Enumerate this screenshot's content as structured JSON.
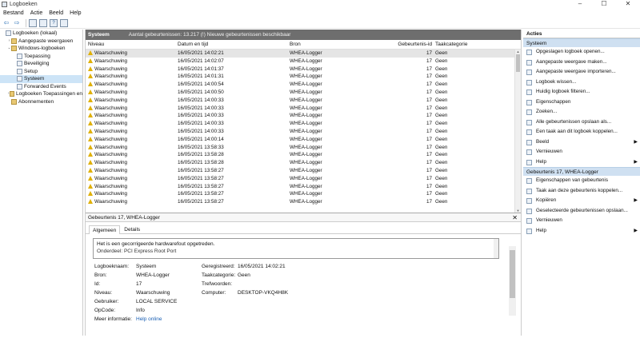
{
  "window": {
    "title": "Logboeken",
    "controls": [
      "–",
      "☐",
      "✕"
    ]
  },
  "menu": [
    "Bestand",
    "Actie",
    "Beeld",
    "Help"
  ],
  "tree": [
    {
      "label": "Logboeken (lokaal)",
      "depth": 0,
      "expand": "",
      "selected": false
    },
    {
      "label": "Aangepaste weergaven",
      "depth": 1,
      "expand": "›",
      "selected": false
    },
    {
      "label": "Windows-logboeken",
      "depth": 1,
      "expand": "⌄",
      "selected": false
    },
    {
      "label": "Toepassing",
      "depth": 2,
      "expand": "",
      "selected": false
    },
    {
      "label": "Beveiliging",
      "depth": 2,
      "expand": "",
      "selected": false
    },
    {
      "label": "Setup",
      "depth": 2,
      "expand": "",
      "selected": false
    },
    {
      "label": "Systeem",
      "depth": 2,
      "expand": "",
      "selected": true
    },
    {
      "label": "Forwarded Events",
      "depth": 2,
      "expand": "",
      "selected": false
    },
    {
      "label": "Logboeken Toepassingen en",
      "depth": 1,
      "expand": "›",
      "selected": false
    },
    {
      "label": "Abonnementen",
      "depth": 1,
      "expand": "",
      "selected": false
    }
  ],
  "log_header": {
    "name": "Systeem",
    "info": "Aantal gebeurtenissen: 13.217 (!) Nieuwe gebeurtenissen beschikbaar"
  },
  "columns": [
    "Niveau",
    "Datum en tijd",
    "Bron",
    "Gebeurtenis-id",
    "Taakcategorie"
  ],
  "events": [
    {
      "level": "Waarschuwing",
      "datetime": "16/05/2021 14:02:21",
      "source": "WHEA-Logger",
      "id": "17",
      "category": "Geen"
    },
    {
      "level": "Waarschuwing",
      "datetime": "16/05/2021 14:02:07",
      "source": "WHEA-Logger",
      "id": "17",
      "category": "Geen"
    },
    {
      "level": "Waarschuwing",
      "datetime": "16/05/2021 14:01:37",
      "source": "WHEA-Logger",
      "id": "17",
      "category": "Geen"
    },
    {
      "level": "Waarschuwing",
      "datetime": "16/05/2021 14:01:31",
      "source": "WHEA-Logger",
      "id": "17",
      "category": "Geen"
    },
    {
      "level": "Waarschuwing",
      "datetime": "16/05/2021 14:00:54",
      "source": "WHEA-Logger",
      "id": "17",
      "category": "Geen"
    },
    {
      "level": "Waarschuwing",
      "datetime": "16/05/2021 14:00:50",
      "source": "WHEA-Logger",
      "id": "17",
      "category": "Geen"
    },
    {
      "level": "Waarschuwing",
      "datetime": "16/05/2021 14:00:33",
      "source": "WHEA-Logger",
      "id": "17",
      "category": "Geen"
    },
    {
      "level": "Waarschuwing",
      "datetime": "16/05/2021 14:00:33",
      "source": "WHEA-Logger",
      "id": "17",
      "category": "Geen"
    },
    {
      "level": "Waarschuwing",
      "datetime": "16/05/2021 14:00:33",
      "source": "WHEA-Logger",
      "id": "17",
      "category": "Geen"
    },
    {
      "level": "Waarschuwing",
      "datetime": "16/05/2021 14:00:33",
      "source": "WHEA-Logger",
      "id": "17",
      "category": "Geen"
    },
    {
      "level": "Waarschuwing",
      "datetime": "16/05/2021 14:00:33",
      "source": "WHEA-Logger",
      "id": "17",
      "category": "Geen"
    },
    {
      "level": "Waarschuwing",
      "datetime": "16/05/2021 14:00:14",
      "source": "WHEA-Logger",
      "id": "17",
      "category": "Geen"
    },
    {
      "level": "Waarschuwing",
      "datetime": "16/05/2021 13:58:33",
      "source": "WHEA-Logger",
      "id": "17",
      "category": "Geen"
    },
    {
      "level": "Waarschuwing",
      "datetime": "16/05/2021 13:58:28",
      "source": "WHEA-Logger",
      "id": "17",
      "category": "Geen"
    },
    {
      "level": "Waarschuwing",
      "datetime": "16/05/2021 13:58:28",
      "source": "WHEA-Logger",
      "id": "17",
      "category": "Geen"
    },
    {
      "level": "Waarschuwing",
      "datetime": "16/05/2021 13:58:27",
      "source": "WHEA-Logger",
      "id": "17",
      "category": "Geen"
    },
    {
      "level": "Waarschuwing",
      "datetime": "16/05/2021 13:58:27",
      "source": "WHEA-Logger",
      "id": "17",
      "category": "Geen"
    },
    {
      "level": "Waarschuwing",
      "datetime": "16/05/2021 13:58:27",
      "source": "WHEA-Logger",
      "id": "17",
      "category": "Geen"
    },
    {
      "level": "Waarschuwing",
      "datetime": "16/05/2021 13:58:27",
      "source": "WHEA-Logger",
      "id": "17",
      "category": "Geen"
    },
    {
      "level": "Waarschuwing",
      "datetime": "16/05/2021 13:58:27",
      "source": "WHEA-Logger",
      "id": "17",
      "category": "Geen"
    }
  ],
  "detail": {
    "title": "Gebeurtenis 17, WHEA-Logger",
    "close": "✕",
    "tabs": [
      "Algemeen",
      "Details"
    ],
    "message_line1": "Het is een gecorrigeerde hardwarefout opgetreden.",
    "message_line2": "Onderdeel: PCI Express Root Port",
    "props_left": [
      {
        "label": "Logboeknaam:",
        "value": "Systeem"
      },
      {
        "label": "Bron:",
        "value": "WHEA-Logger"
      },
      {
        "label": "Id:",
        "value": "17"
      },
      {
        "label": "Niveau:",
        "value": "Waarschuwing"
      },
      {
        "label": "Gebruiker:",
        "value": "LOCAL SERVICE"
      },
      {
        "label": "OpCode:",
        "value": "Info"
      },
      {
        "label": "Meer informatie:",
        "value": "Help online"
      }
    ],
    "props_right": [
      {
        "label": "Geregistreerd:",
        "value": "16/05/2021 14:02:21"
      },
      {
        "label": "Taakcategorie:",
        "value": "Geen"
      },
      {
        "label": "Trefwoorden:",
        "value": ""
      },
      {
        "label": "Computer:",
        "value": "DESKTOP-VKQ4H8K"
      }
    ]
  },
  "actions": {
    "header": "Acties",
    "section1": "Systeem",
    "items1": [
      {
        "label": "Opgeslagen logboek openen...",
        "submenu": false
      },
      {
        "label": "Aangepaste weergave maken...",
        "submenu": false
      },
      {
        "label": "Aangepaste weergave importeren...",
        "submenu": false
      },
      {
        "label": "Logboek wissen...",
        "submenu": false
      },
      {
        "label": "Huidig logboek filteren...",
        "submenu": false
      },
      {
        "label": "Eigenschappen",
        "submenu": false
      },
      {
        "label": "Zoeken...",
        "submenu": false
      },
      {
        "label": "Alle gebeurtenissen opslaan als...",
        "submenu": false
      },
      {
        "label": "Een taak aan dit logboek koppelen...",
        "submenu": false
      },
      {
        "label": "Beeld",
        "submenu": true
      },
      {
        "label": "Vernieuwen",
        "submenu": false
      },
      {
        "label": "Help",
        "submenu": true
      }
    ],
    "section2": "Gebeurtenis 17, WHEA-Logger",
    "items2": [
      {
        "label": "Eigenschappen van gebeurtenis",
        "submenu": false
      },
      {
        "label": "Taak aan deze gebeurtenis koppelen...",
        "submenu": false
      },
      {
        "label": "Kopiëren",
        "submenu": true
      },
      {
        "label": "Geselecteerde gebeurtenissen opslaan...",
        "submenu": false
      },
      {
        "label": "Vernieuwen",
        "submenu": false
      },
      {
        "label": "Help",
        "submenu": true
      }
    ]
  }
}
